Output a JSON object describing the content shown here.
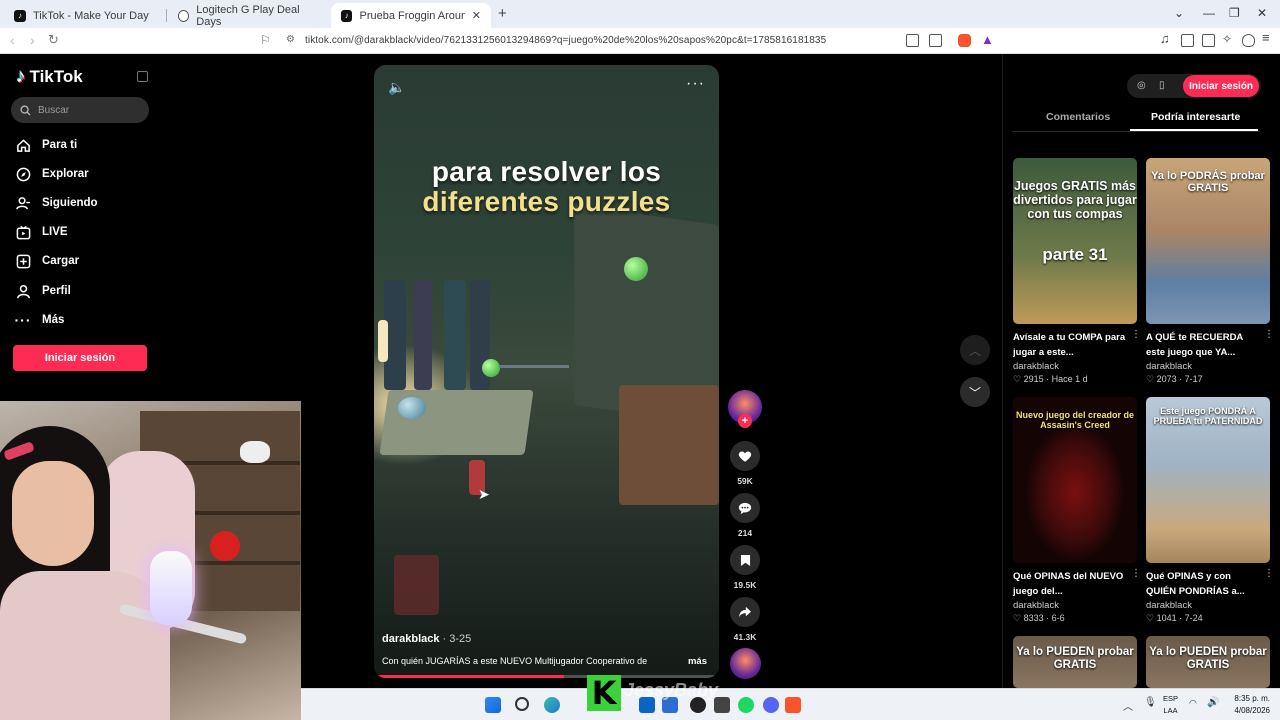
{
  "browser": {
    "tabs": [
      {
        "title": "TikTok - Make Your Day"
      },
      {
        "title": "Logitech G Play Deal Days"
      },
      {
        "title": "Prueba Froggin Around: Mult"
      }
    ],
    "url": "tiktok.com/@darakblack/video/7621331256013294869?q=juego%20de%20los%20sapos%20pc&t=1785816181835"
  },
  "sidebar": {
    "brand": "TikTok",
    "search_placeholder": "Buscar",
    "items": [
      {
        "label": "Para ti",
        "icon": "home-icon"
      },
      {
        "label": "Explorar",
        "icon": "compass-icon"
      },
      {
        "label": "Siguiendo",
        "icon": "following-icon"
      },
      {
        "label": "LIVE",
        "icon": "live-icon"
      },
      {
        "label": "Cargar",
        "icon": "upload-icon"
      },
      {
        "label": "Perfil",
        "icon": "profile-icon"
      },
      {
        "label": "Más",
        "icon": "more-icon"
      }
    ],
    "login_label": "Iniciar sesión"
  },
  "video": {
    "caption_line1": "para resolver los",
    "caption_line2": "diferentes puzzles",
    "author": "darakblack",
    "date": "· 3-25",
    "description": "Con quién JUGARÍAS a este NUEVO Multijugador Cooperativo de",
    "more": "más",
    "progress": 0.55
  },
  "actions": {
    "likes": "59K",
    "comments": "214",
    "saves": "19.5K",
    "shares": "41.3K"
  },
  "right": {
    "login_label": "Iniciar sesión",
    "tab_comments": "Comentarios",
    "tab_suggest": "Podría interesarte",
    "cards": [
      {
        "thumb_text": "Juegos GRATIS más divertidos para jugar con tus compas",
        "thumb_big": "parte 31",
        "title": "Avísale a tu COMPA para jugar a este...",
        "author": "darakblack",
        "meta": "♡ 2915 · Hace 1 d"
      },
      {
        "thumb_text": "Ya lo PODRÁS probar GRATIS",
        "thumb_big": "",
        "title": "A QUÉ te RECUERDA este juego que YA...",
        "author": "darakblack",
        "meta": "♡ 2073 · 7-17"
      },
      {
        "thumb_text": "Nuevo juego del creador de Assasin's Creed",
        "thumb_big": "",
        "title": "Qué OPINAS del NUEVO juego del...",
        "author": "darakblack",
        "meta": "♡ 8333 · 6-6"
      },
      {
        "thumb_text": "Este juego PONDRÁ A PRUEBA tu PATERNIDAD",
        "thumb_big": "",
        "title": "Qué OPINAS y con QUIÉN PONDRÍAS a...",
        "author": "darakblack",
        "meta": "♡ 1041 · 7-24"
      },
      {
        "thumb_text": "Ya lo PUEDEN probar GRATIS",
        "thumb_big": "",
        "title": "",
        "author": "",
        "meta": ""
      },
      {
        "thumb_text": "Ya lo PUEDEN probar GRATIS",
        "thumb_big": "",
        "title": "",
        "author": "",
        "meta": ""
      }
    ]
  },
  "overlay": {
    "letter": "K",
    "name": "JessyBaby"
  },
  "taskbar": {
    "lang1": "ESP",
    "lang2": "LAA",
    "time": "8:35 p. m.",
    "date": "4/08/2026"
  }
}
